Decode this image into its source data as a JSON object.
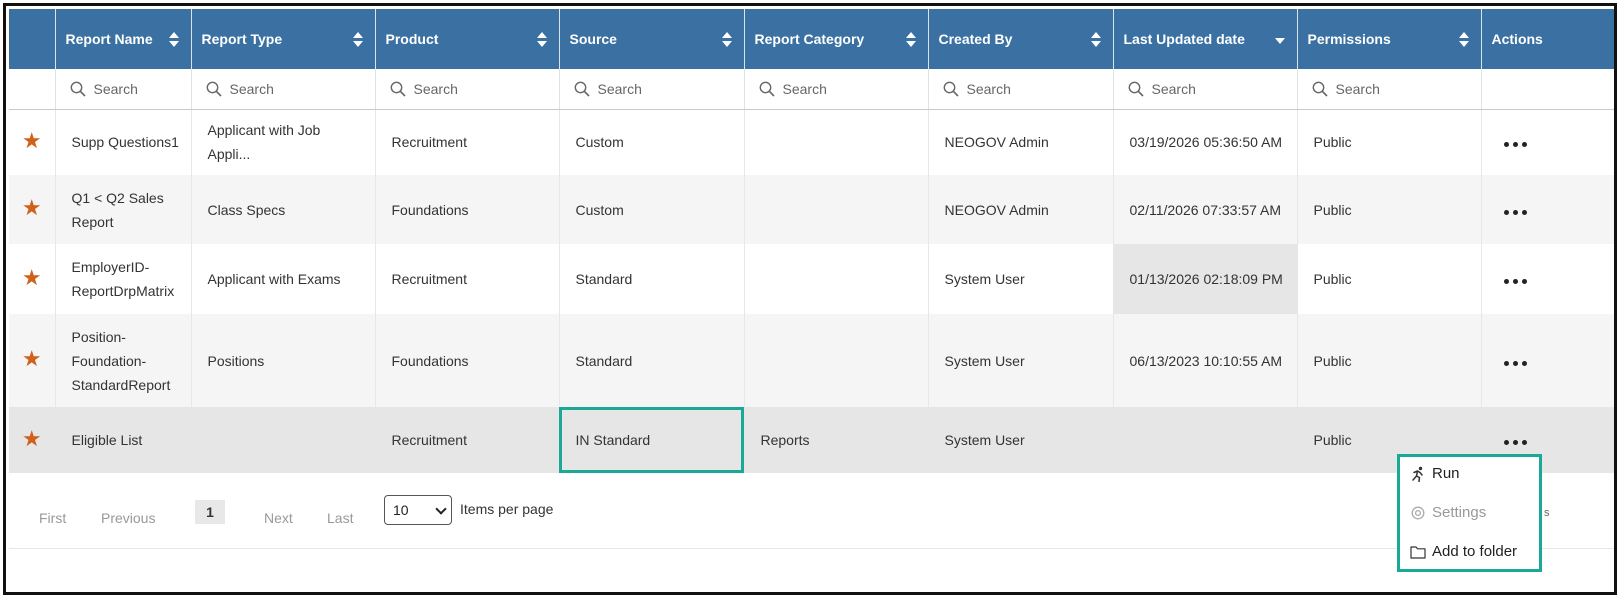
{
  "columns": [
    {
      "label": "",
      "sort": "none"
    },
    {
      "label": "Report Name",
      "sort": "both"
    },
    {
      "label": "Report Type",
      "sort": "both"
    },
    {
      "label": "Product",
      "sort": "both"
    },
    {
      "label": "Source",
      "sort": "both"
    },
    {
      "label": "Report Category",
      "sort": "both"
    },
    {
      "label": "Created By",
      "sort": "both"
    },
    {
      "label": "Last Updated date",
      "sort": "desc"
    },
    {
      "label": "Permissions",
      "sort": "both"
    },
    {
      "label": "Actions",
      "sort": "none"
    }
  ],
  "search_placeholder": "Search",
  "rows": [
    {
      "name": "Supp Questions1",
      "type": "Applicant with Job Appli...",
      "product": "Recruitment",
      "source": "Custom",
      "category": "",
      "created_by": "NEOGOV Admin",
      "updated": "03/19/2026 05:36:50 AM",
      "permissions": "Public"
    },
    {
      "name": "Q1 < Q2 Sales Report",
      "type": "Class Specs",
      "product": "Foundations",
      "source": "Custom",
      "category": "",
      "created_by": "NEOGOV Admin",
      "updated": "02/11/2026 07:33:57 AM",
      "permissions": "Public"
    },
    {
      "name": "EmployerID-ReportDrpMatrix",
      "type": "Applicant with Exams",
      "product": "Recruitment",
      "source": "Standard",
      "category": "",
      "created_by": "System User",
      "updated": "01/13/2026 02:18:09 PM",
      "permissions": "Public"
    },
    {
      "name": "Position-Foundation-StandardReport",
      "type": "Positions",
      "product": "Foundations",
      "source": "Standard",
      "category": "",
      "created_by": "System User",
      "updated": "06/13/2023 10:10:55 AM",
      "permissions": "Public"
    },
    {
      "name": "Eligible List",
      "type": "",
      "product": "Recruitment",
      "source": "IN Standard",
      "category": "Reports",
      "created_by": "System User",
      "updated": "",
      "permissions": "Public"
    }
  ],
  "pagination": {
    "first": "First",
    "previous": "Previous",
    "current_page": "1",
    "next": "Next",
    "last": "Last",
    "page_size": "10",
    "items_per_page_label": "Items per page"
  },
  "action_menu": {
    "run": "Run",
    "settings": "Settings",
    "add_to_folder": "Add to folder"
  },
  "colors": {
    "header_bg": "#3a71a2",
    "star": "#d0611b",
    "focus_outline": "#1aa897"
  },
  "icons": {
    "favorite": "star-icon",
    "search": "search-icon",
    "actions": "more-horizontal-icon",
    "run": "running-person-icon",
    "settings": "settings-icon",
    "folder": "folder-icon"
  }
}
